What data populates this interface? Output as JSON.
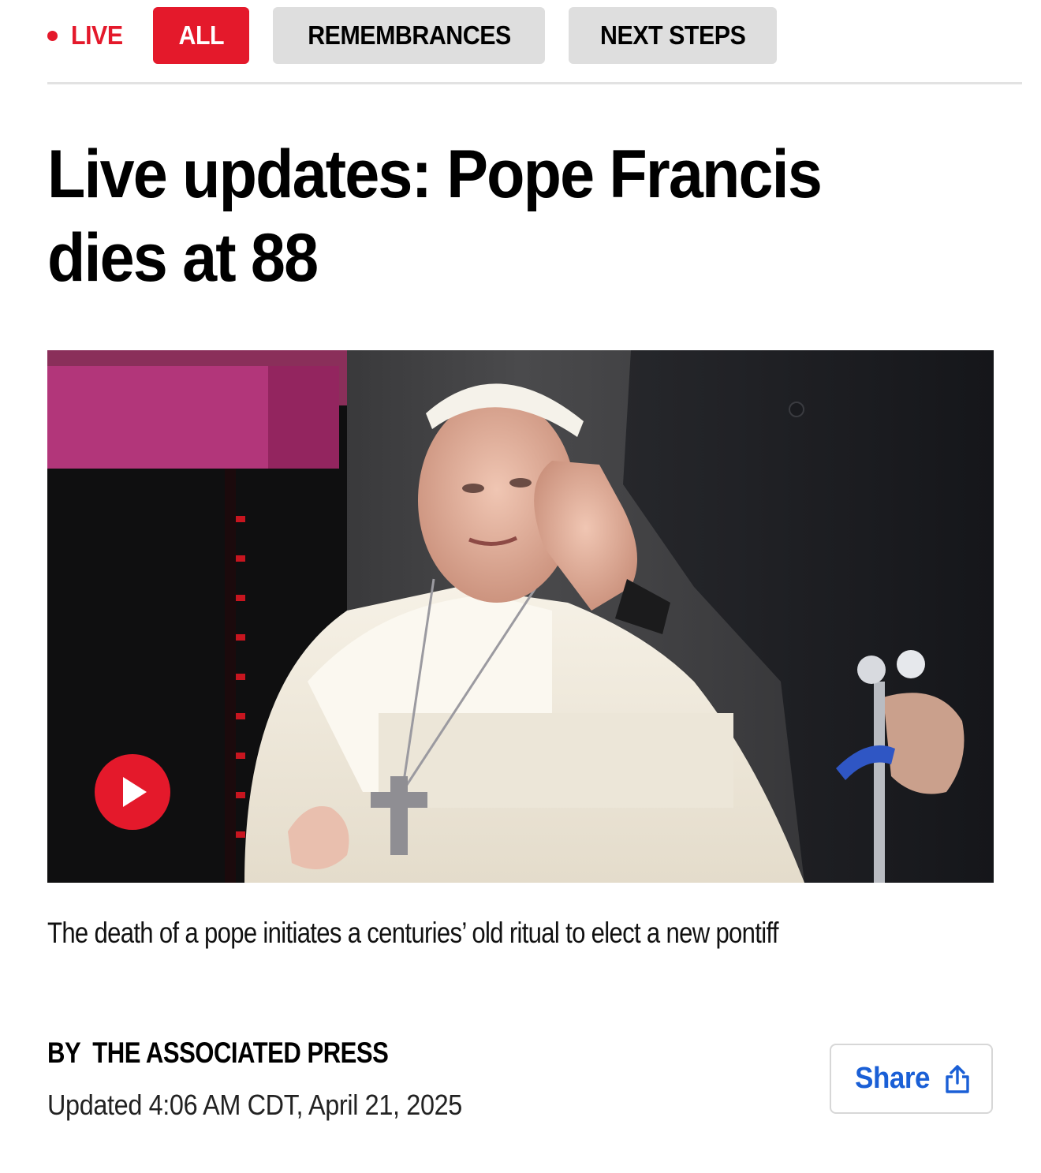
{
  "nav": {
    "live_label": "LIVE",
    "tabs": [
      {
        "label": "ALL",
        "active": true
      },
      {
        "label": "REMEMBRANCES",
        "active": false
      },
      {
        "label": "NEXT STEPS",
        "active": false
      }
    ]
  },
  "article": {
    "headline_line1": "Live updates: Pope Francis",
    "headline_line2": "dies at 88",
    "caption": "The death of a pope initiates a centuries’ old ritual to elect a new pontiff",
    "byline_prefix": "BY",
    "byline_author": "THE ASSOCIATED PRESS",
    "updated": "Updated 4:06 AM CDT, April 21, 2025",
    "share_label": "Share"
  },
  "media": {
    "play_icon": "play-icon",
    "description_icon": "hero-photo"
  },
  "colors": {
    "accent": "#e4192b",
    "tab_inactive": "#dedede",
    "link": "#1a5fd6"
  }
}
